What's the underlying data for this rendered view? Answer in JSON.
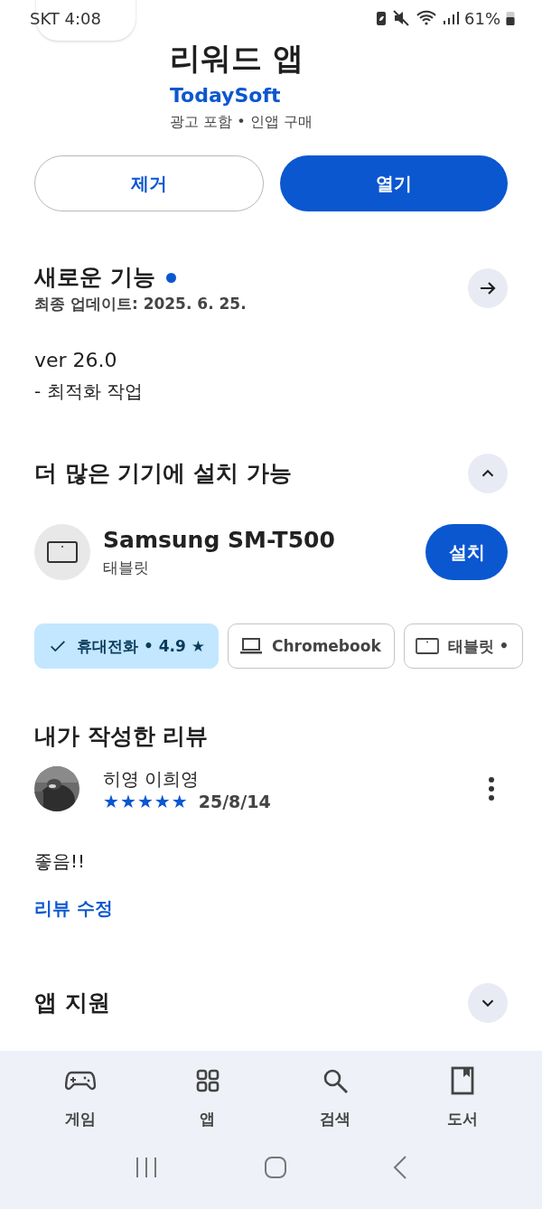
{
  "status_bar": {
    "carrier": "SKT",
    "time": "4:08",
    "battery": "61%"
  },
  "app": {
    "title": "리워드 앱",
    "developer": "TodaySoft",
    "meta": "광고 포함 • 인앱 구매"
  },
  "actions": [
    {
      "label": "제거",
      "kind": "outlined"
    },
    {
      "label": "열기",
      "kind": "filled"
    }
  ],
  "whats_new": {
    "title": "새로운 기능",
    "unread": true,
    "updated": "최종 업데이트: 2025. 6. 25.",
    "notes": [
      "ver 26.0",
      "- 최적화 작업"
    ]
  },
  "devices": {
    "title": "더 많은 기기에 설치 가능",
    "expanded": true,
    "device": {
      "name": "Samsung SM-T500",
      "type": "태블릿",
      "button": "설치"
    },
    "chips": [
      {
        "label": "휴대전화 • 4.9 ★",
        "kind": "phone",
        "selected": true
      },
      {
        "label": "Chromebook",
        "kind": "laptop",
        "selected": false
      },
      {
        "label": "태블릿 •",
        "kind": "tablet",
        "selected": false
      }
    ]
  },
  "my_review": {
    "title": "내가 작성한 리뷰",
    "author": "히영 이희영",
    "stars": 5,
    "date": "25/8/14",
    "text": "좋음!!",
    "edit": "리뷰 수정"
  },
  "support": {
    "title": "앱 지원",
    "expanded": false
  },
  "bottom_nav": [
    {
      "label": "게임",
      "kind": "games"
    },
    {
      "label": "앱",
      "kind": "apps"
    },
    {
      "label": "검색",
      "kind": "search"
    },
    {
      "label": "도서",
      "kind": "books"
    }
  ]
}
